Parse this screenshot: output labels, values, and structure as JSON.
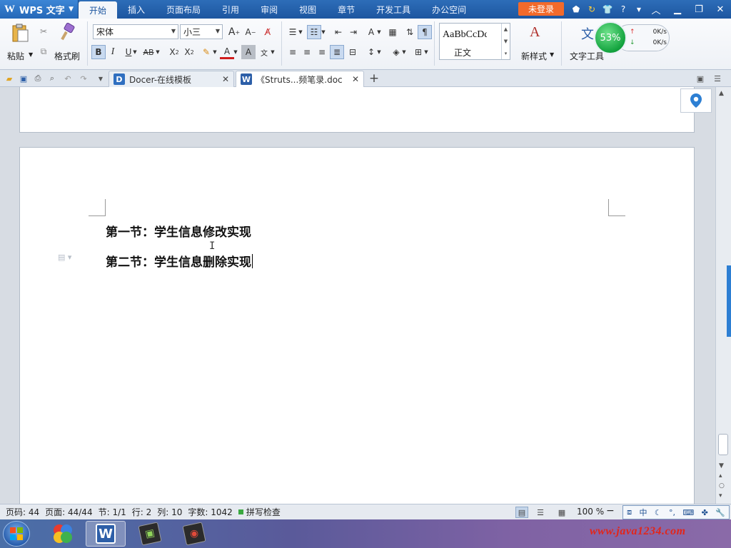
{
  "app": {
    "name": "WPS 文字",
    "logo": "W"
  },
  "menu": [
    {
      "label": "开始",
      "active": true
    },
    {
      "label": "插入"
    },
    {
      "label": "页面布局"
    },
    {
      "label": "引用"
    },
    {
      "label": "审阅"
    },
    {
      "label": "视图"
    },
    {
      "label": "章节"
    },
    {
      "label": "开发工具"
    },
    {
      "label": "办公空间"
    }
  ],
  "login_label": "未登录",
  "ribbon": {
    "paste_label": "粘贴",
    "format_painter_label": "格式刷",
    "font_name": "宋体",
    "font_size": "小三",
    "style_sample": "AaBbCcDd",
    "style_name": "正文",
    "new_style_label": "新样式",
    "text_tools_label": "文字工具"
  },
  "meter": {
    "percent": "53%",
    "up": "0K/s",
    "down": "0K/s"
  },
  "tabs": [
    {
      "label": "Docer-在线模板",
      "icon": "D",
      "color": "#2f6fc0"
    },
    {
      "label": "《Struts...频笔录.doc",
      "icon": "W",
      "color": "#2d5fa8",
      "active": true
    }
  ],
  "document": {
    "paragraphs": [
      "第一节：学生信息修改实现",
      "第二节：学生信息删除实现"
    ]
  },
  "status": {
    "page_no": "页码: 44",
    "pages": "页面: 44/44",
    "section": "节: 1/1",
    "row": "行: 2",
    "col": "列: 10",
    "words": "字数: 1042",
    "spell": "拼写检查",
    "zoom": "100 %",
    "ime_lang": "中"
  },
  "watermark": "www.java1234.com",
  "colors": {
    "title_bar": "#1d56a0",
    "accent": "#f26a2b",
    "meter_green": "#13a33e"
  }
}
